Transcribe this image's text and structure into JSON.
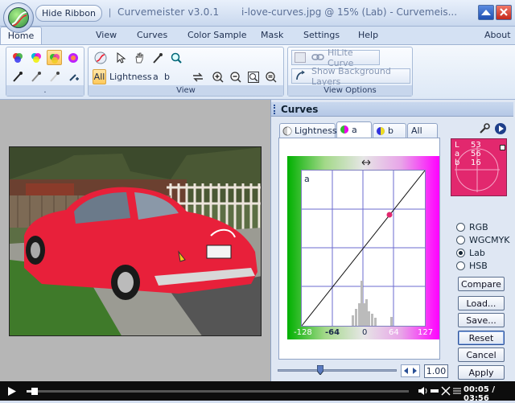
{
  "titlebar": {
    "hide_ribbon": "Hide Ribbon",
    "app": "Curvemeister v3.0.1",
    "document": "i-love-curves.jpg @ 15% (Lab)  -  Curvemeis..."
  },
  "tabs": [
    "Home",
    "View",
    "Curves",
    "Color Sample",
    "Mask",
    "Settings",
    "Help"
  ],
  "about": "About",
  "groups": {
    "view_label": "View",
    "view_options_label": "View Options",
    "tools_label": "."
  },
  "view_tools": {
    "all": "All",
    "lightness": "Lightness",
    "a": "a",
    "b": "b"
  },
  "view_options": {
    "hilite": "HiLite Curve",
    "show_bg": "Show Background Layers"
  },
  "panel": {
    "title": "Curves",
    "tabs": [
      "Lightness",
      "a",
      "b",
      "All"
    ],
    "channel_label": "a"
  },
  "axis": {
    "ticks": [
      "-128",
      "-64",
      "0",
      "64",
      "127"
    ]
  },
  "readout": {
    "rows": [
      {
        "label": "L",
        "value": "53"
      },
      {
        "label": "a",
        "value": "56"
      },
      {
        "label": "b",
        "value": "16"
      }
    ]
  },
  "color_modes": [
    "RGB",
    "WGCMYK",
    "Lab",
    "HSB"
  ],
  "selected_mode": "Lab",
  "buttons": [
    "Compare",
    "Load...",
    "Save...",
    "Reset",
    "Cancel",
    "Apply"
  ],
  "slider": {
    "value": "1.00"
  },
  "player": {
    "time": "00:05 / 03:56",
    "progress": 0.022
  },
  "colors": {
    "accent": "#2a4f96",
    "magenta": "#ff00ff",
    "readout": "#e2286e"
  }
}
